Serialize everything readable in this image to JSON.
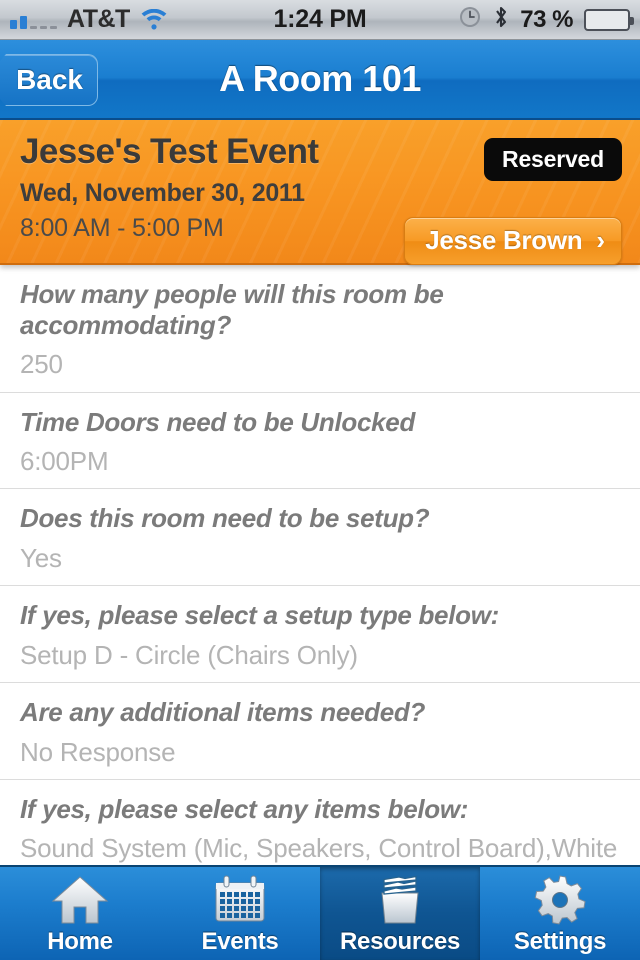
{
  "status_bar": {
    "carrier": "AT&T",
    "signal_bars_filled": 2,
    "signal_bars_total": 5,
    "wifi_icon": "wifi-icon",
    "time": "1:24 PM",
    "alarm_icon": "alarm-clock-icon",
    "bluetooth_icon": "bluetooth-icon",
    "battery_percent": "73 %",
    "battery_level": 73
  },
  "nav": {
    "back_label": "Back",
    "title": "A Room 101"
  },
  "event": {
    "title": "Jesse's Test Event",
    "date": "Wed, November 30, 2011",
    "time_range": "8:00 AM - 5:00 PM",
    "status_badge": "Reserved",
    "owner_name": "Jesse Brown",
    "owner_chevron": "›",
    "accent_color": "#f79320",
    "badge_bg": "#0a0a0a"
  },
  "questions": [
    {
      "question": "How many people will this room be accommodating?",
      "answer": "250"
    },
    {
      "question": "Time Doors need to be Unlocked",
      "answer": "6:00PM"
    },
    {
      "question": "Does this room need to be setup?",
      "answer": "Yes"
    },
    {
      "question": "If yes, please select a setup type below:",
      "answer": "Setup D - Circle (Chairs Only)"
    },
    {
      "question": "Are any additional items needed?",
      "answer": "No Response"
    },
    {
      "question": "If yes, please select any items below:",
      "answer": "Sound System (Mic, Speakers, Control Board),White Board and Markers"
    }
  ],
  "tabs": [
    {
      "label": "Home",
      "icon": "home-icon",
      "active": false
    },
    {
      "label": "Events",
      "icon": "calendar-icon",
      "active": false
    },
    {
      "label": "Resources",
      "icon": "file-box-icon",
      "active": true
    },
    {
      "label": "Settings",
      "icon": "gear-icon",
      "active": false
    }
  ]
}
